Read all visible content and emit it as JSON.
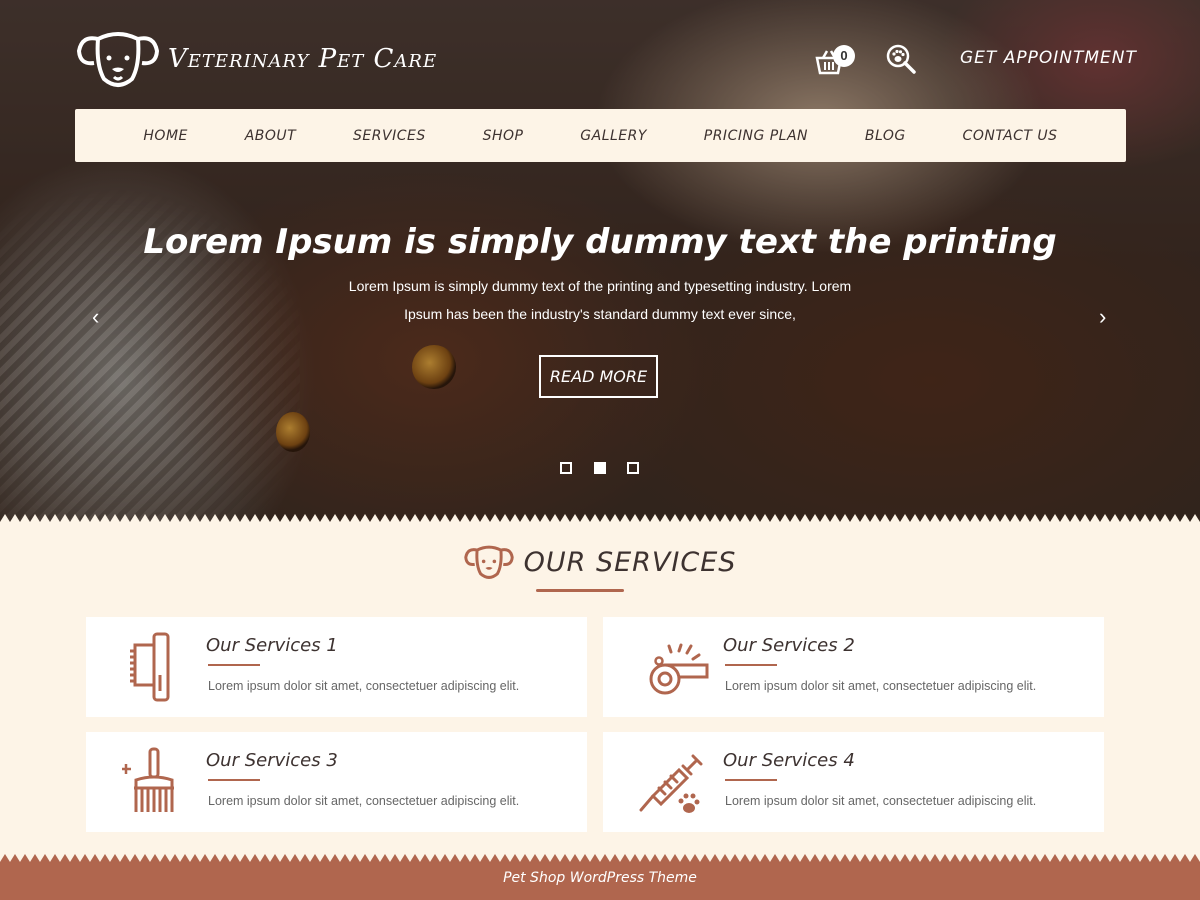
{
  "header": {
    "site_title": "Veterinary Pet Care",
    "cart_count": "0",
    "appointment_label": "Get Appointment"
  },
  "nav": {
    "items": [
      {
        "label": "Home"
      },
      {
        "label": "About"
      },
      {
        "label": "Services"
      },
      {
        "label": "Shop"
      },
      {
        "label": "Gallery"
      },
      {
        "label": "Pricing Plan"
      },
      {
        "label": "Blog"
      },
      {
        "label": "Contact Us"
      }
    ]
  },
  "slider": {
    "title": "Lorem Ipsum is simply dummy text the printing",
    "text_line1": "Lorem Ipsum is simply dummy text of the printing and typesetting industry. Lorem",
    "text_line2": "Ipsum has been the industry's standard dummy text ever since,",
    "button_label": "Read More",
    "prev_icon": "‹",
    "next_icon": "›",
    "active_slide": 2,
    "slide_count": 3
  },
  "services": {
    "heading": "Our Services",
    "items": [
      {
        "title": "Our Services 1",
        "desc": "Lorem ipsum dolor sit amet, consectetuer adipiscing elit.",
        "icon": "grooming-brush-icon"
      },
      {
        "title": "Our Services 2",
        "desc": "Lorem ipsum dolor sit amet, consectetuer adipiscing elit.",
        "icon": "whistle-icon"
      },
      {
        "title": "Our Services 3",
        "desc": "Lorem ipsum dolor sit amet, consectetuer adipiscing elit.",
        "icon": "cleaning-brush-icon"
      },
      {
        "title": "Our Services 4",
        "desc": "Lorem ipsum dolor sit amet, consectetuer adipiscing elit.",
        "icon": "syringe-icon"
      }
    ]
  },
  "footer": {
    "text": "Pet Shop WordPress Theme"
  },
  "colors": {
    "accent": "#b0664e",
    "cream": "#fdf4e7",
    "text_dark": "#3d3230"
  }
}
